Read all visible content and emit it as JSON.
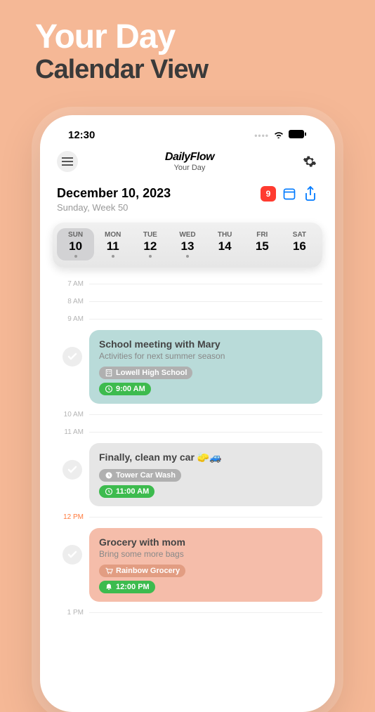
{
  "hero": {
    "title": "Your Day",
    "subtitle": "Calendar View"
  },
  "status": {
    "time": "12:30"
  },
  "header": {
    "app_name": "DailyFlow",
    "app_sub": "Your Day"
  },
  "date": {
    "main": "December 10, 2023",
    "sub": "Sunday, Week 50",
    "badge": "9"
  },
  "week": [
    {
      "name": "SUN",
      "num": "10",
      "dot": true,
      "active": true
    },
    {
      "name": "MON",
      "num": "11",
      "dot": true,
      "active": false
    },
    {
      "name": "TUE",
      "num": "12",
      "dot": true,
      "active": false
    },
    {
      "name": "WED",
      "num": "13",
      "dot": true,
      "active": false
    },
    {
      "name": "THU",
      "num": "14",
      "dot": false,
      "active": false
    },
    {
      "name": "FRI",
      "num": "15",
      "dot": false,
      "active": false
    },
    {
      "name": "SAT",
      "num": "16",
      "dot": false,
      "active": false
    }
  ],
  "times": {
    "t7": "7 AM",
    "t8": "8 AM",
    "t9": "9 AM",
    "t10": "10 AM",
    "t11": "11 AM",
    "t12": "12 PM",
    "t13": "1 PM"
  },
  "events": [
    {
      "title": "School meeting with Mary",
      "desc": "Activities for next summer season",
      "location": "Lowell High School",
      "time": "9:00 AM",
      "color": "teal",
      "loc_icon": "building",
      "time_icon": "clock"
    },
    {
      "title": "Finally, clean my car 🧽🚙",
      "desc": "",
      "location": "Tower Car Wash",
      "time": "11:00 AM",
      "color": "gray",
      "loc_icon": "clock",
      "time_icon": "clock"
    },
    {
      "title": "Grocery with mom",
      "desc": "Bring some more bags",
      "location": "Rainbow Grocery",
      "time": "12:00 PM",
      "color": "peach",
      "loc_icon": "cart",
      "time_icon": "bell"
    }
  ]
}
